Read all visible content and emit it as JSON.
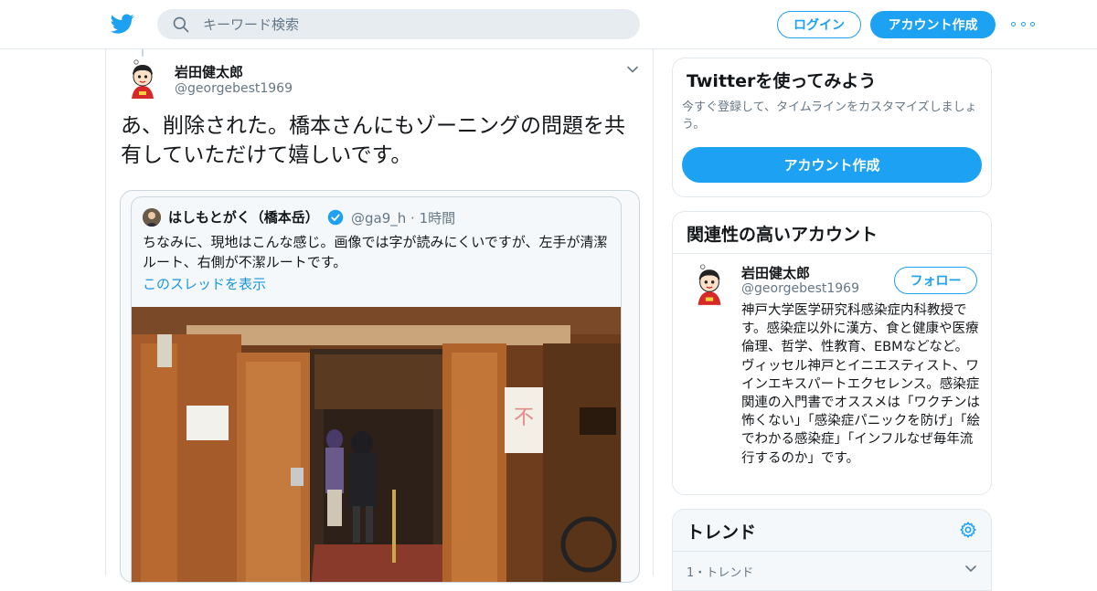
{
  "header": {
    "logo_icon": "twitter-bird-icon",
    "search_placeholder": "キーワード検索",
    "login_label": "ログイン",
    "signup_label": "アカウント作成",
    "more_icon": "more-dots-icon",
    "brand_color": "#1da1f2"
  },
  "tweet": {
    "author_name": "岩田健太郎",
    "author_handle": "@georgebest1969",
    "text": "あ、削除された。橋本さんにもゾーニングの問題を共有していただけて嬉しいです。",
    "quoted": {
      "author_name": "はしもとがく（橋本岳）",
      "author_handle": "@ga9_h · 1時間",
      "text": "ちなみに、現地はこんな感じ。画像では字が読みにくいですが、左手が清潔ルート、右側が不潔ルートです。",
      "show_thread_label": "このスレッドを表示"
    }
  },
  "sidebar": {
    "signup_card": {
      "title": "Twitterを使ってみよう",
      "subtitle": "今すぐ登録して、タイムラインをカスタマイズしましょう。",
      "button_label": "アカウント作成"
    },
    "related_accounts": {
      "title": "関連性の高いアカウント",
      "account": {
        "name": "岩田健太郎",
        "handle": "@georgebest1969",
        "follow_label": "フォロー",
        "bio": "神戸大学医学研究科感染症内科教授です。感染症以外に漢方、食と健康や医療倫理、哲学、性教育、EBMなどなど。ヴィッセル神戸とイニエスティスト、ワインエキスパートエクセレンス。感染症関連の入門書でオススメは「ワクチンは怖くない」「感染症パニックを防げ」「絵でわかる感染症」「インフルなぜ毎年流行するのか」です。"
      }
    },
    "trends": {
      "title": "トレンド",
      "first_meta": "1・トレンド"
    }
  }
}
